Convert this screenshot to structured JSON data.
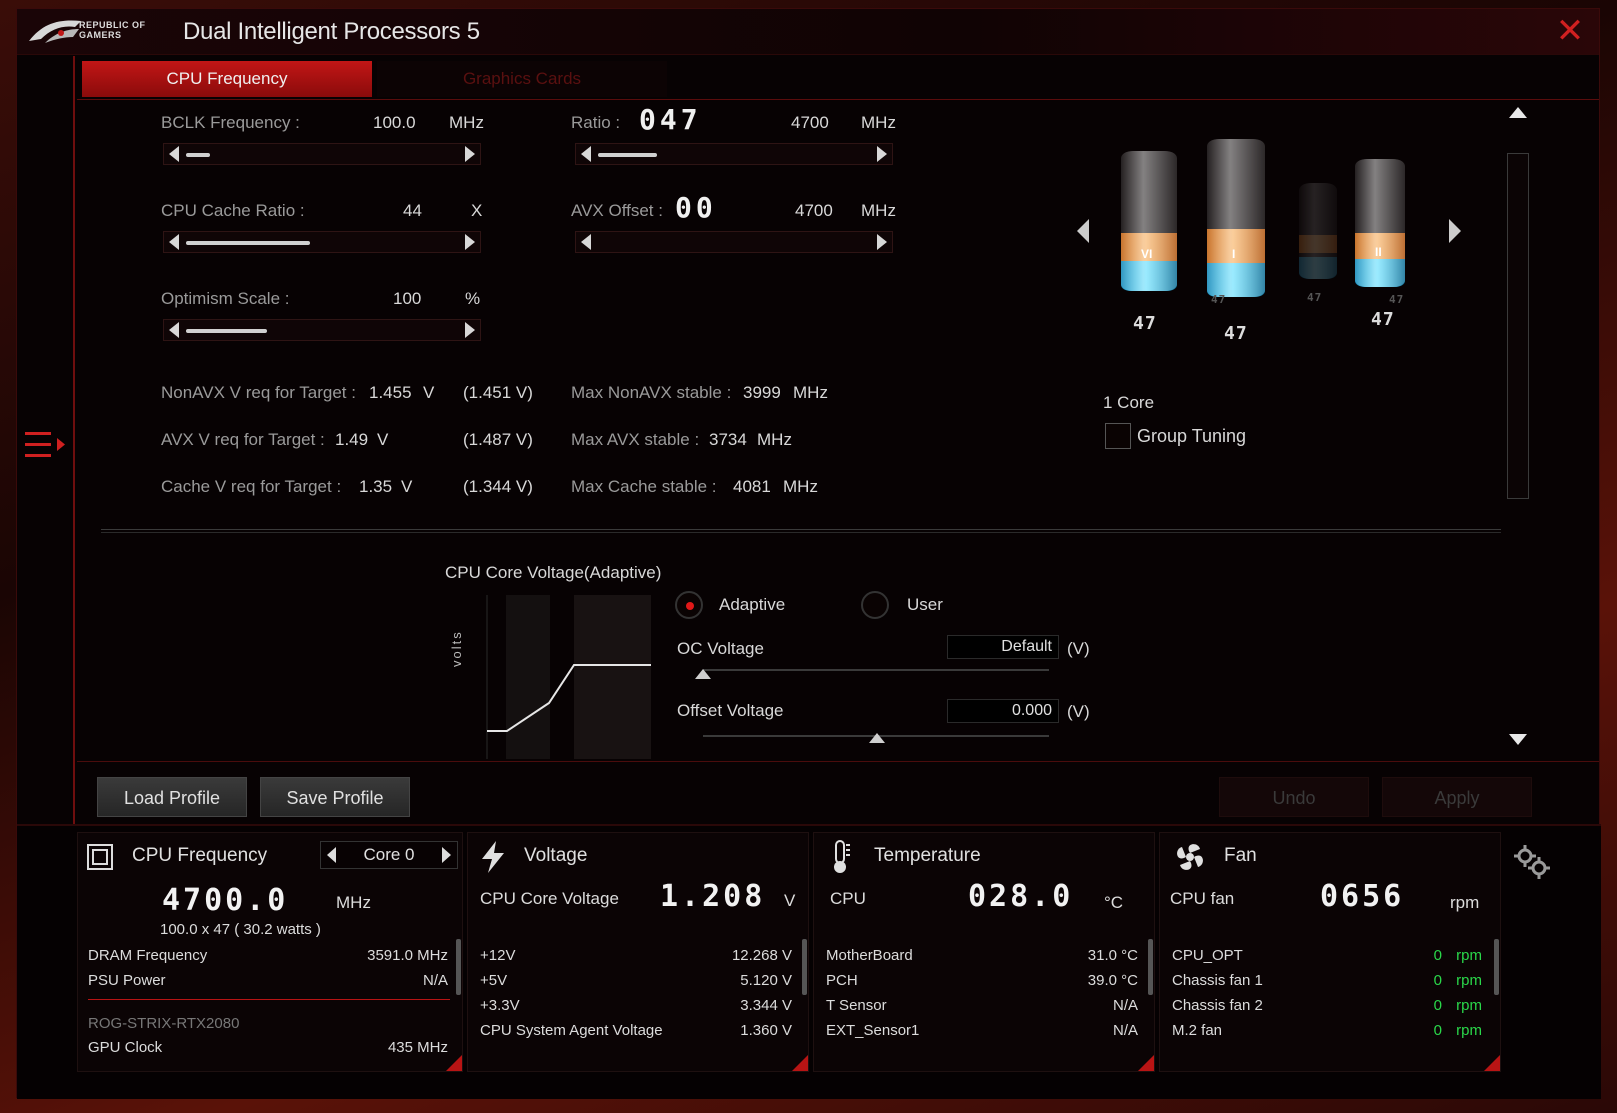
{
  "window": {
    "logo_text_line1": "REPUBLIC OF",
    "logo_text_line2": "GAMERS",
    "title": "Dual Intelligent Processors 5",
    "close_glyph": "✕"
  },
  "tabs": [
    {
      "label": "CPU Frequency",
      "active": true
    },
    {
      "label": "Graphics Cards",
      "active": false
    }
  ],
  "settings": {
    "bclk": {
      "label": "BCLK Frequency :",
      "value": "100.0",
      "unit": "MHz",
      "level": 0.08
    },
    "cache_ratio": {
      "label": "CPU Cache Ratio :",
      "value": "44",
      "unit": "X",
      "level": 0.46
    },
    "optimism": {
      "label": "Optimism Scale :",
      "value": "100",
      "unit": "%",
      "level": 0.3
    },
    "ratio": {
      "label": "Ratio :",
      "seg": "047",
      "value": "4700",
      "unit": "MHz",
      "level": 0.22
    },
    "avx_offset": {
      "label": "AVX Offset :",
      "seg": "00",
      "value": "4700",
      "unit": "MHz",
      "level": 0.0
    }
  },
  "readouts": {
    "nonavx": {
      "label": "NonAVX V req for Target :",
      "value": "1.455",
      "unit": "V",
      "paren": "(1.451  V)"
    },
    "avx": {
      "label": "AVX V req for Target :",
      "value": "1.49",
      "unit": "V",
      "paren": "(1.487  V)"
    },
    "cache": {
      "label": "Cache V req for Target :",
      "value": "1.35",
      "unit": "V",
      "paren": "(1.344  V)"
    },
    "max_nonavx": {
      "label": "Max NonAVX stable :",
      "value": "3999",
      "unit": "MHz"
    },
    "max_avx": {
      "label": "Max AVX stable :",
      "value": "3734",
      "unit": "MHz"
    },
    "max_cache": {
      "label": "Max Cache stable :",
      "value": "4081",
      "unit": "MHz"
    }
  },
  "cores": {
    "labels": [
      "VI",
      "I",
      "",
      "II"
    ],
    "values": [
      "47",
      "47",
      "47",
      "47"
    ],
    "ghost_values": [
      "47",
      "47",
      "47"
    ],
    "count_label": "1 Core",
    "group_tuning_label": "Group Tuning"
  },
  "voltage": {
    "title": "CPU Core Voltage(Adaptive)",
    "axis_label": "volts",
    "mode_adaptive": "Adaptive",
    "mode_user": "User",
    "oc_label": "OC Voltage",
    "oc_value": "Default",
    "oc_unit": "(V)",
    "offset_label": "Offset Voltage",
    "offset_value": "0.000",
    "offset_unit": "(V)"
  },
  "buttons": {
    "load": "Load Profile",
    "save": "Save Profile",
    "undo": "Undo",
    "apply": "Apply"
  },
  "monitor": {
    "cpu": {
      "title": "CPU Frequency",
      "core_select": "Core 0",
      "big": "4700.0",
      "big_unit": "MHz",
      "sub": "100.0   x  47      ( 30.2 watts )",
      "rows": [
        {
          "name": "DRAM Frequency",
          "value": "3591.0  MHz"
        },
        {
          "name": "PSU Power",
          "value": "N/A"
        }
      ],
      "gpu_name": "ROG-STRIX-RTX2080",
      "gpu_clock_label": "GPU Clock",
      "gpu_clock_value": "435 MHz"
    },
    "voltage": {
      "title": "Voltage",
      "main_label": "CPU Core Voltage",
      "big": "1.208",
      "big_unit": "V",
      "rows": [
        {
          "name": "+12V",
          "value": "12.268  V"
        },
        {
          "name": "+5V",
          "value": "5.120  V"
        },
        {
          "name": "+3.3V",
          "value": "3.344  V"
        },
        {
          "name": "CPU System Agent Voltage",
          "value": "1.360  V"
        }
      ]
    },
    "temperature": {
      "title": "Temperature",
      "main_label": "CPU",
      "big": "028.0",
      "big_unit": "°C",
      "rows": [
        {
          "name": "MotherBoard",
          "value": "31.0 °C"
        },
        {
          "name": "PCH",
          "value": "39.0 °C"
        },
        {
          "name": "T Sensor",
          "value": "N/A"
        },
        {
          "name": "EXT_Sensor1",
          "value": "N/A"
        }
      ]
    },
    "fan": {
      "title": "Fan",
      "main_label": "CPU fan",
      "big": "0656",
      "big_unit": "rpm",
      "rows": [
        {
          "name": "CPU_OPT",
          "value": "0",
          "unit": "rpm"
        },
        {
          "name": "Chassis fan 1",
          "value": "0",
          "unit": "rpm"
        },
        {
          "name": "Chassis fan 2",
          "value": "0",
          "unit": "rpm"
        },
        {
          "name": "M.2 fan",
          "value": "0",
          "unit": "rpm"
        }
      ]
    }
  },
  "colors": {
    "accent": "#c21616",
    "fan_rpm": "#2ad84a",
    "core_blue": "#40d8ff",
    "core_orange": "#f6a040"
  }
}
